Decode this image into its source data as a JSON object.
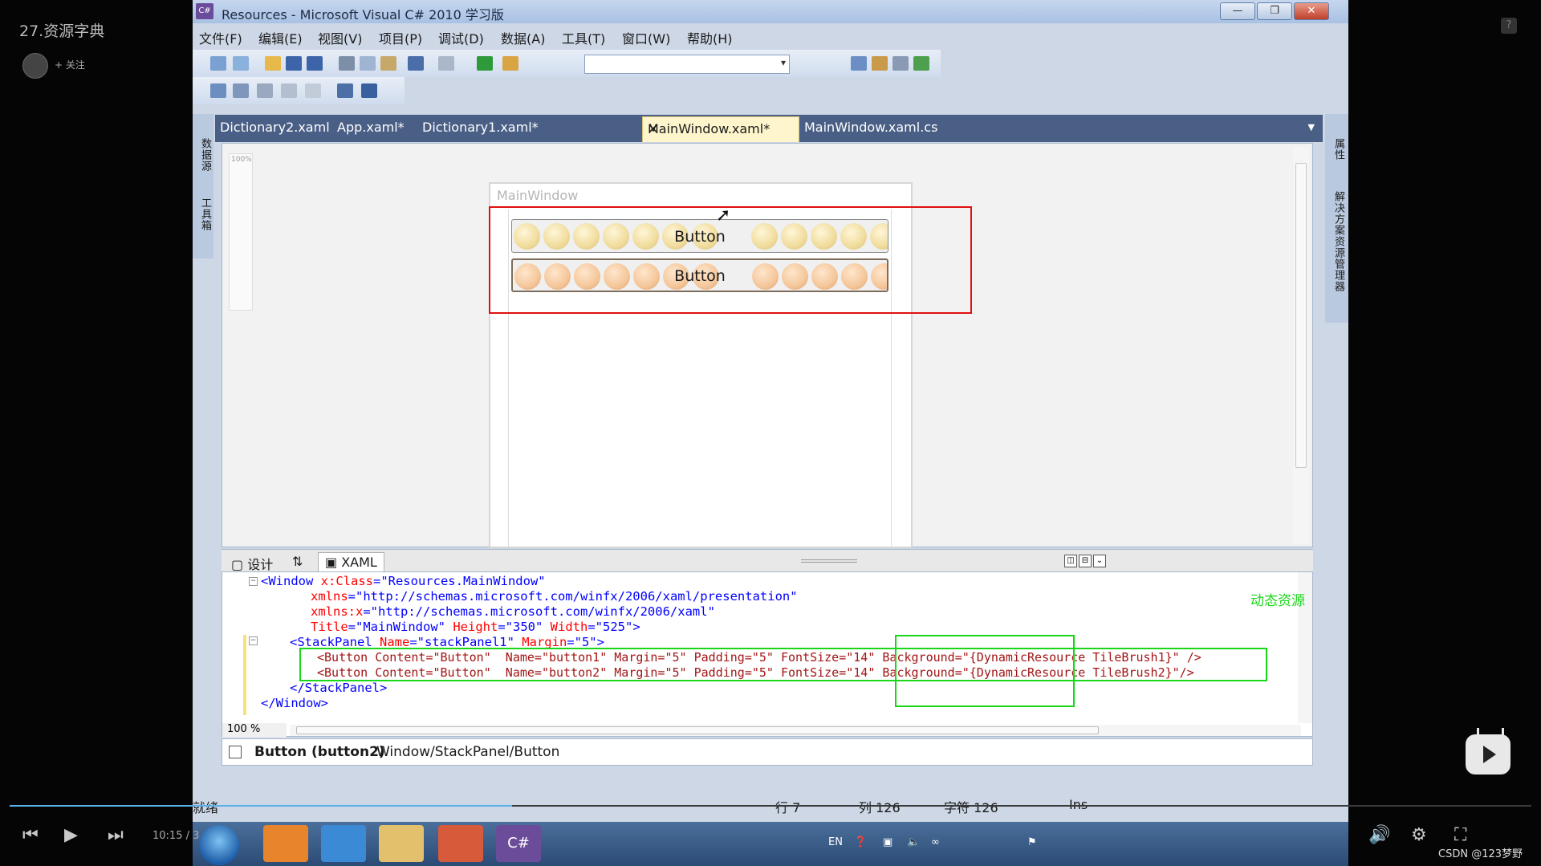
{
  "player": {
    "video_title": "27.资源字典",
    "follow_label": "+ 关注",
    "time": "10:15 / 3",
    "watermark": "CSDN @123梦野",
    "progress": 0.33
  },
  "window": {
    "title": "Resources - Microsoft Visual C# 2010 学习版",
    "minimize": "—",
    "restore": "❐",
    "close": "✕"
  },
  "menu": [
    "文件(F)",
    "编辑(E)",
    "视图(V)",
    "项目(P)",
    "调试(D)",
    "数据(A)",
    "工具(T)",
    "窗口(W)",
    "帮助(H)"
  ],
  "side_panels": {
    "left": [
      "数据源",
      "工具箱"
    ],
    "right": [
      "属性",
      "解决方案资源管理器"
    ]
  },
  "tabs": [
    {
      "label": "Dictionary2.xaml"
    },
    {
      "label": "App.xaml*"
    },
    {
      "label": "Dictionary1.xaml*"
    },
    {
      "label": "MainWindow.xaml*",
      "active": true
    },
    {
      "label": "MainWindow.xaml.cs"
    }
  ],
  "designer": {
    "zoom_label": "100%",
    "window_title": "MainWindow",
    "button1": "Button",
    "button2": "Button"
  },
  "views": {
    "design": "设计",
    "swap": "⇅",
    "xaml": "XAML"
  },
  "code": {
    "line1_a": "<Window ",
    "line1_b": "x:Class",
    "line1_c": "=\"Resources.MainWindow\"",
    "line2_a": "xmlns",
    "line2_b": "=\"http://schemas.microsoft.com/winfx/2006/xaml/presentation\"",
    "line3_a": "xmlns:x",
    "line3_b": "=\"http://schemas.microsoft.com/winfx/2006/xaml\"",
    "line4_a": "Title",
    "line4_b": "=\"MainWindow\" ",
    "line4_c": "Height",
    "line4_d": "=\"350\" ",
    "line4_e": "Width",
    "line4_f": "=\"525\">",
    "line5_a": "<StackPanel ",
    "line5_b": "Name",
    "line5_c": "=\"stackPanel1\" ",
    "line5_d": "Margin",
    "line5_e": "=\"5\">",
    "line6": "<Button Content=\"Button\"  Name=\"button1\" Margin=\"5\" Padding=\"5\" FontSize=\"14\" Background=\"{DynamicResource TileBrush1}\" />",
    "line7": "<Button Content=\"Button\"  Name=\"button2\" Margin=\"5\" Padding=\"5\" FontSize=\"14\" Background=\"{DynamicResource TileBrush2}\"/>",
    "line8": "</StackPanel>",
    "line9": "</Window>",
    "annotation": "动态资源",
    "zoom": "100 %"
  },
  "breadcrumb": {
    "element": "Button (button2)",
    "path": "Window/StackPanel/Button"
  },
  "status": {
    "ready": "就绪",
    "row": "行 7",
    "col": "列 126",
    "char": "字符 126",
    "mode": "Ins"
  },
  "taskbar": {
    "lang": "EN",
    "vs_label": "C#"
  },
  "colors": {
    "highlight_red": "#e01010",
    "highlight_green": "#18d718",
    "tab_bar": "#4a5f86",
    "active_tab": "#fff5cc"
  }
}
